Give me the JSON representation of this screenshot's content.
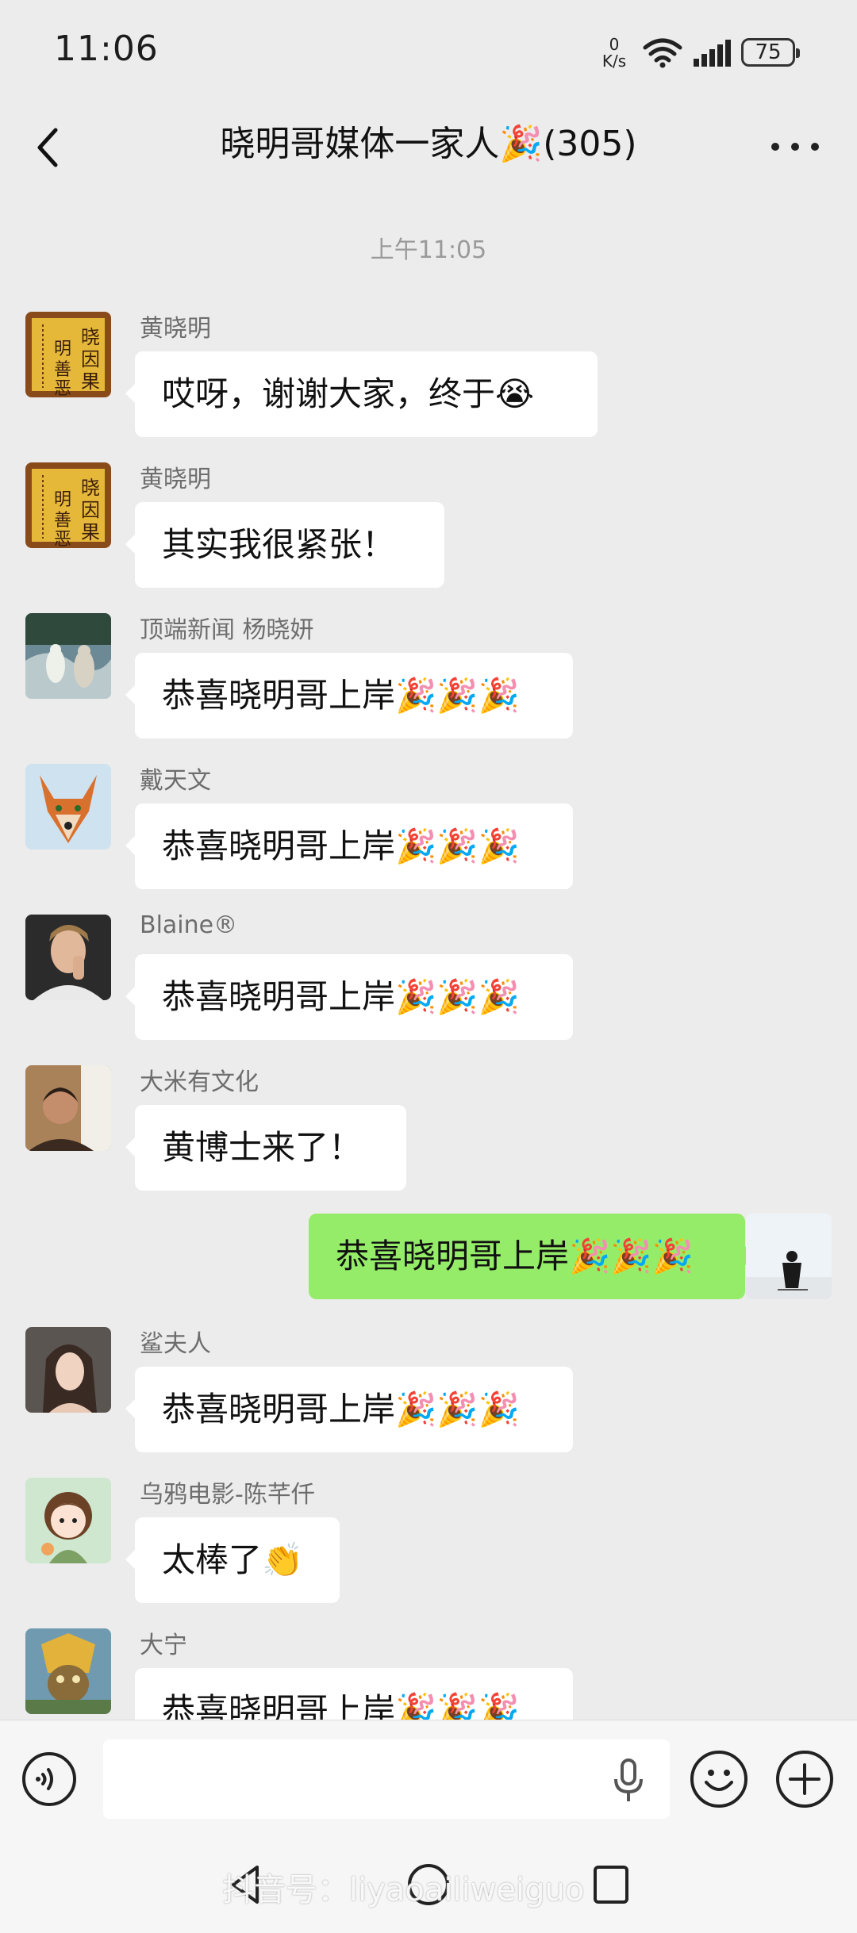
{
  "status": {
    "time": "11:06",
    "net_speed_value": "0",
    "net_speed_unit": "K/s",
    "battery": "75"
  },
  "header": {
    "title": "晓明哥媒体一家人🎉(305)"
  },
  "timestamp": "上午11:05",
  "messages": [
    {
      "sender": "黄晓明",
      "text": "哎呀，谢谢大家，终于😭",
      "avatar": "avatar-plaque"
    },
    {
      "sender": "黄晓明",
      "text": "其实我很紧张！",
      "avatar": "avatar-plaque"
    },
    {
      "sender": "顶端新闻 杨晓妍",
      "text": "恭喜晓明哥上岸🎉🎉🎉",
      "avatar": "avatar-photo-animals"
    },
    {
      "sender": "戴天文",
      "text": "恭喜晓明哥上岸🎉🎉🎉",
      "avatar": "avatar-fox"
    },
    {
      "sender": "Blaine®",
      "text": "恭喜晓明哥上岸🎉🎉🎉",
      "avatar": "avatar-man-portrait"
    },
    {
      "sender": "大米有文化",
      "text": "黄博士来了！",
      "avatar": "avatar-man-photo"
    },
    {
      "sender": "",
      "text": "恭喜晓明哥上岸🎉🎉🎉",
      "avatar": "avatar-self",
      "mine": true
    },
    {
      "sender": "鲨夫人",
      "text": "恭喜晓明哥上岸🎉🎉🎉",
      "avatar": "avatar-woman"
    },
    {
      "sender": "乌鸦电影-陈芊仟",
      "text": "太棒了👏",
      "avatar": "avatar-cartoon-girl"
    },
    {
      "sender": "大宁",
      "text": "恭喜晓明哥上岸🎉🎉🎉",
      "avatar": "avatar-game-character"
    }
  ],
  "avatar_plaque_text": "晓因果明善恶",
  "watermark": "抖音号：liyaoailiweiguo",
  "icons": [
    "back-icon",
    "more-icon",
    "voice-icon",
    "mic-icon",
    "emoji-icon",
    "plus-icon",
    "nav-back-icon",
    "nav-home-icon",
    "nav-recent-icon"
  ],
  "colors": {
    "background": "#ececec",
    "bubble_self": "#95ec69",
    "bubble_other": "#ffffff"
  }
}
